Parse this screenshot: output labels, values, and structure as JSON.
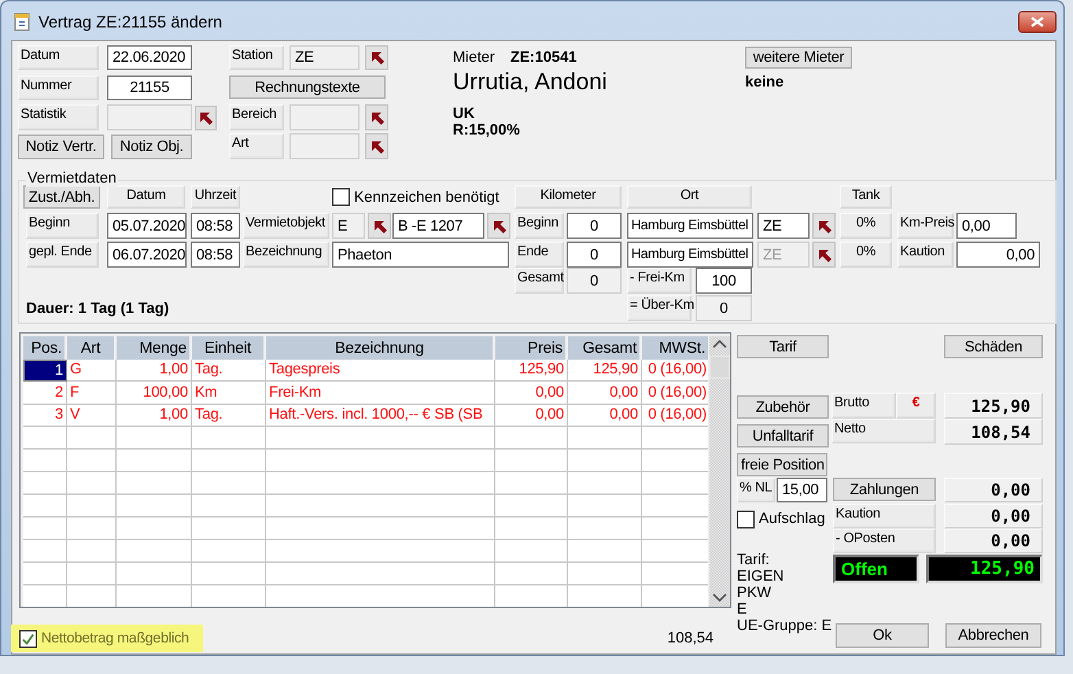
{
  "window": {
    "title": "Vertrag ZE:21155 ändern"
  },
  "contract": {
    "date_label": "Datum",
    "date": "22.06.2020",
    "number_label": "Nummer",
    "number": "21155",
    "statistics_label": "Statistik",
    "note_buttons": [
      "Notiz Vertr.",
      "Notiz Obj."
    ]
  },
  "station": {
    "label": "Station",
    "value": "ZE",
    "invoice_texts_button": "Rechnungstexte",
    "area_label": "Bereich",
    "type_label": "Art"
  },
  "tenant": {
    "label": "Mieter",
    "id": "ZE:10541",
    "name": "Urrutia, Andoni",
    "info": [
      "UK",
      "R:15,00%"
    ],
    "more_button": "weitere Mieter",
    "more_value": "keine"
  },
  "rental": {
    "title": "Vermietdaten",
    "pickup_button": "Zust./Abh.",
    "date_header": "Datum",
    "time_header": "Uhrzeit",
    "rows": [
      {
        "label": "Beginn",
        "date": "05.07.2020",
        "time": "08:58"
      },
      {
        "label": "gepl. Ende",
        "date": "06.07.2020",
        "time": "08:58"
      }
    ],
    "plate_required": {
      "label": "Kennzeichen benötigt",
      "checked": false
    },
    "object": {
      "label": "Vermietobjekt",
      "group": "E",
      "plate": "B -E  1207"
    },
    "description": {
      "label": "Bezeichnung",
      "value": "Phaeton"
    },
    "duration": "Dauer: 1 Tag  (1 Tag)"
  },
  "kilometers": {
    "header": "Kilometer",
    "rows": [
      {
        "label": "Beginn",
        "value": "0",
        "editable": true
      },
      {
        "label": "Ende",
        "value": "0",
        "editable": true
      },
      {
        "label": "Gesamt",
        "value": "0",
        "editable": false
      }
    ]
  },
  "places": {
    "header": "Ort",
    "rows": [
      {
        "place": "Hamburg Eimsbüttel",
        "station": "ZE",
        "disabled": false
      },
      {
        "place": "Hamburg Eimsbüttel",
        "station": "ZE",
        "disabled": true
      }
    ],
    "free_km": {
      "label": "- Frei-Km",
      "value": "100"
    },
    "over_km": {
      "label": "= Über-Km",
      "value": "0"
    }
  },
  "tank": {
    "header": "Tank",
    "values": [
      "0%",
      "0%"
    ]
  },
  "km_price": {
    "label": "Km-Preis",
    "value": "0,00"
  },
  "deposit": {
    "label": "Kaution",
    "value": "0,00"
  },
  "table": {
    "columns": [
      "Pos.",
      "Art",
      "Menge",
      "Einheit",
      "Bezeichnung",
      "Preis",
      "Gesamt",
      "MWSt."
    ],
    "rows": [
      {
        "cells": [
          "1",
          "G",
          "1,00",
          "Tag.",
          "Tagespreis",
          "125,90",
          "125,90",
          "0 (16,00)"
        ],
        "selected": true
      },
      {
        "cells": [
          "2",
          "F",
          "100,00",
          "Km",
          "Frei-Km",
          "0,00",
          "0,00",
          "0 (16,00)"
        ],
        "selected": false
      },
      {
        "cells": [
          "3",
          "V",
          "1,00",
          "Tag.",
          "Haft.-Vers. incl. 1000,-- € SB (SB",
          "0,00",
          "0,00",
          "0 (16,00)"
        ],
        "selected": false
      }
    ]
  },
  "net_amount": {
    "label": "Nettobetrag maßgeblich",
    "checked": true,
    "highlighted": true
  },
  "table_total": "108,54",
  "side": {
    "tariff_button": "Tarif",
    "damages_button": "Schäden",
    "accessories_button": "Zubehör",
    "accident_tariff_button": "Unfalltarif",
    "free_position_button": "freie Position",
    "nl": {
      "label": "% NL",
      "value": "15,00"
    },
    "surcharge": {
      "label": "Aufschlag",
      "checked": false
    },
    "tariff_info": [
      "Tarif:",
      "EIGEN",
      "PKW",
      "E",
      "UE-Gruppe: E"
    ]
  },
  "totals": {
    "gross": {
      "label": "Brutto",
      "currency": "€",
      "value": "125,90"
    },
    "net": {
      "label": "Netto",
      "value": "108,54"
    },
    "payments": {
      "button": "Zahlungen",
      "value": "0,00"
    },
    "deposit": {
      "label": "Kaution",
      "value": "0,00"
    },
    "open_items": {
      "label": "- OPosten",
      "value": "0,00"
    },
    "open": {
      "label": "Offen",
      "value": "125,90"
    }
  },
  "buttons": [
    "Ok",
    "Abbrechen"
  ]
}
